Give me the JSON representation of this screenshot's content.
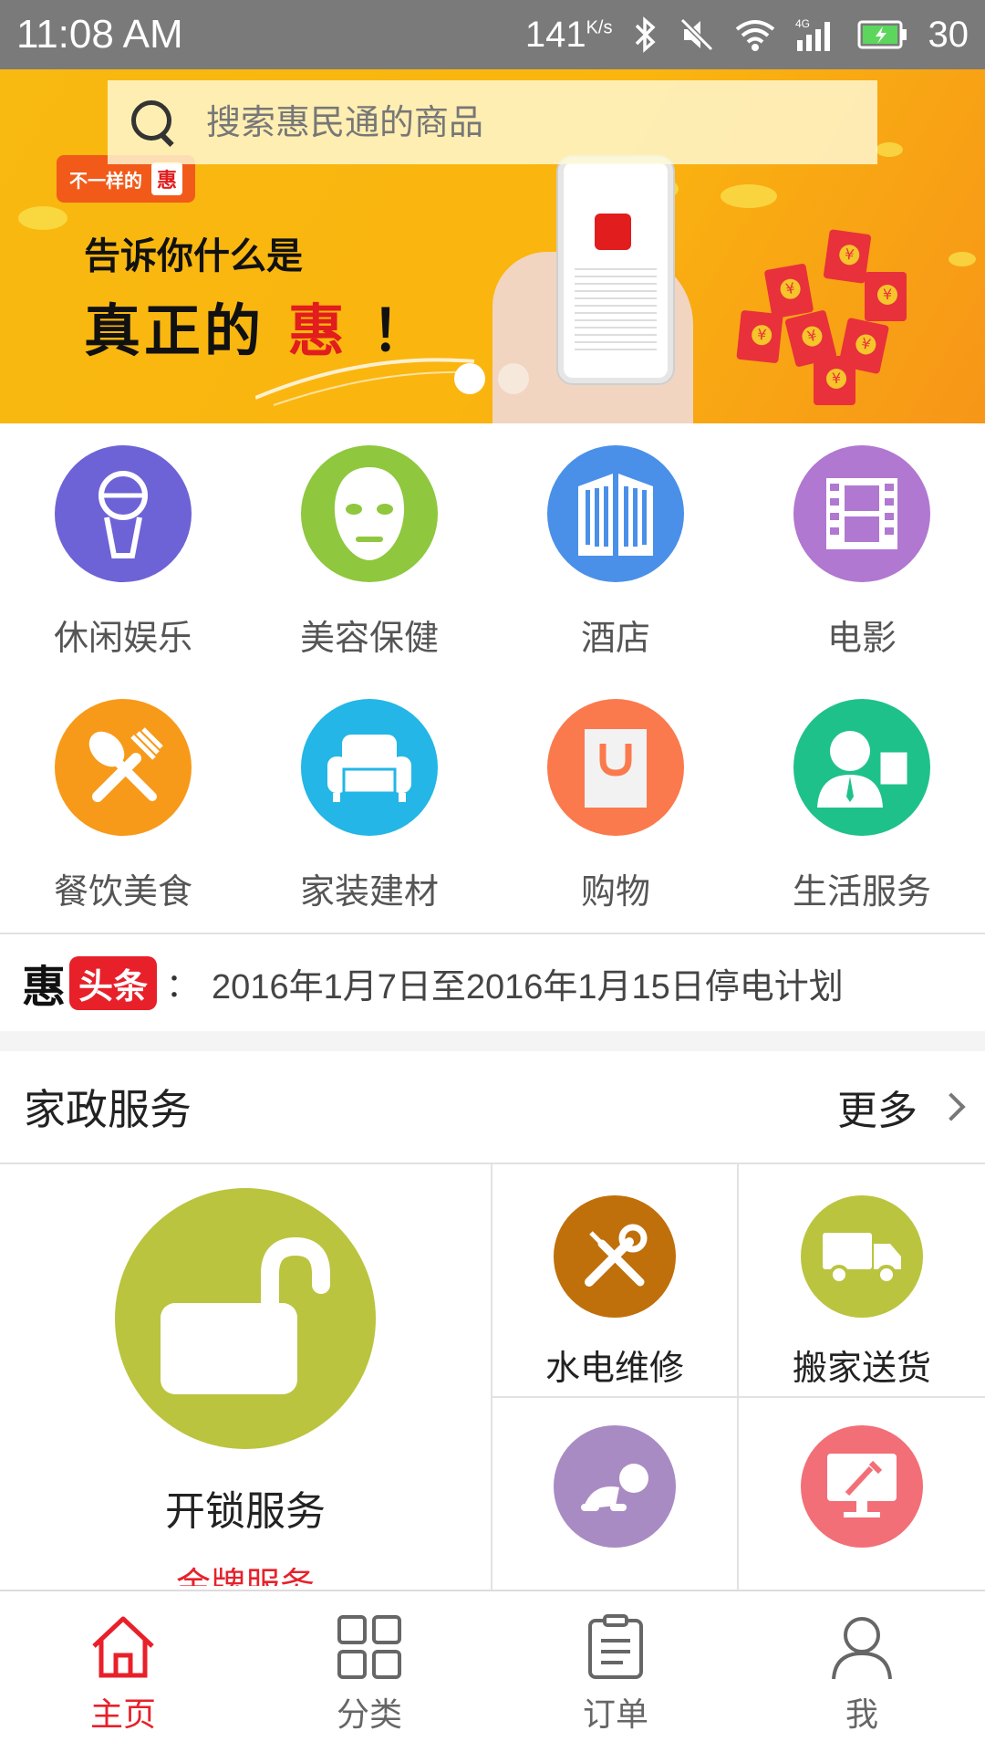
{
  "status": {
    "time": "11:08 AM",
    "speed": "141",
    "speed_unit": "K/s",
    "battery": "30"
  },
  "search": {
    "placeholder": "搜索惠民通的商品"
  },
  "banner": {
    "tag": "不一样的",
    "tag_hui": "惠",
    "line1": "告诉你什么是",
    "line2a": "真正的",
    "line2b": "惠",
    "line2c": "！"
  },
  "categories": [
    {
      "label": "休闲娱乐",
      "color": "#6d63d6",
      "icon": "ice-cream-icon"
    },
    {
      "label": "美容保健",
      "color": "#8fc73e",
      "icon": "face-mask-icon"
    },
    {
      "label": "酒店",
      "color": "#4a90e8",
      "icon": "building-icon"
    },
    {
      "label": "电影",
      "color": "#b078d0",
      "icon": "film-icon"
    },
    {
      "label": "餐饮美食",
      "color": "#f79a1a",
      "icon": "spoon-fork-icon"
    },
    {
      "label": "家装建材",
      "color": "#23b6e6",
      "icon": "sofa-icon"
    },
    {
      "label": "购物",
      "color": "#fa7a4e",
      "icon": "shopping-bag-icon"
    },
    {
      "label": "生活服务",
      "color": "#1fc18a",
      "icon": "service-person-icon"
    }
  ],
  "news": {
    "hui": "惠",
    "tag": "头条",
    "colon": "：",
    "text": "2016年1月7日至2016年1月15日停电计划"
  },
  "section": {
    "title": "家政服务",
    "more": "更多"
  },
  "services": {
    "big": {
      "name": "开锁服务",
      "sub": "金牌服务",
      "color": "#bac43e",
      "icon": "unlock-icon"
    },
    "cells": [
      {
        "name": "水电维修",
        "color": "#c0700a",
        "icon": "repair-tools-icon"
      },
      {
        "name": "搬家送货",
        "color": "#bac43e",
        "icon": "truck-icon"
      },
      {
        "name": "",
        "color": "#a98bc4",
        "icon": "baby-crawl-icon"
      },
      {
        "name": "",
        "color": "#f26f78",
        "icon": "cleaning-monitor-icon"
      }
    ]
  },
  "tabs": [
    {
      "label": "主页",
      "icon": "home-icon",
      "active": true
    },
    {
      "label": "分类",
      "icon": "grid-icon",
      "active": false
    },
    {
      "label": "订单",
      "icon": "clipboard-icon",
      "active": false
    },
    {
      "label": "我",
      "icon": "user-icon",
      "active": false
    }
  ],
  "colors": {
    "accent": "#e8202a",
    "banner": "#f8b910"
  }
}
